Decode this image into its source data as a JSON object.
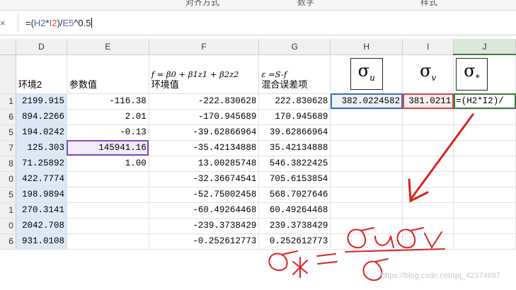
{
  "ribbon": {
    "labels": [
      "对齐方式",
      "数字",
      "样式"
    ]
  },
  "formula_bar": {
    "cancel_glyph": "×",
    "formula": {
      "p1": "=(",
      "ref1": "H2",
      "p2": "*",
      "ref2": "I2",
      "p3": ")/",
      "ref3": "E5",
      "p4": "^0.5"
    }
  },
  "colors": {
    "ref_h2": "#3b6fb6",
    "ref_i2": "#d24b4b",
    "ref_e5": "#7a4fc4",
    "annotation": "#e02020"
  },
  "columns": [
    "D",
    "E",
    "F",
    "G",
    "H",
    "I",
    "J"
  ],
  "header_row": {
    "d": "环境2",
    "e": "参数值",
    "f_formula": "f = β0 + β1z1 + β2z2",
    "f": "环境值",
    "g_formula": "ε =S-f",
    "g": "混合误差项",
    "h_sub": "u",
    "i_sub": "v",
    "j_sub": "*",
    "sigma": "σ"
  },
  "row_labels": [
    "1",
    "6",
    "5",
    "7",
    "8",
    "0",
    "5",
    "1",
    "0",
    "6"
  ],
  "rows": [
    {
      "d": "2199.915",
      "e": "-116.38",
      "f": "-222.830628",
      "g": "222.830628",
      "h": "382.0224582",
      "i": "381.0211",
      "j": "=(H2*I2)/"
    },
    {
      "d": "894.2266",
      "e": "2.01",
      "f": "-170.945689",
      "g": "170.945689",
      "h": "",
      "i": "",
      "j": ""
    },
    {
      "d": "194.0242",
      "e": "-0.13",
      "f": "-39.62866964",
      "g": "39.62866964",
      "h": "",
      "i": "",
      "j": ""
    },
    {
      "d": "125.303",
      "e": "145941.16",
      "f": "-35.42134888",
      "g": "35.42134888",
      "h": "",
      "i": "",
      "j": ""
    },
    {
      "d": "71.25892",
      "e": "1.00",
      "f": "13.00285748",
      "g": "546.3822425",
      "h": "",
      "i": "",
      "j": ""
    },
    {
      "d": "422.7774",
      "e": "",
      "f": "-32.36674541",
      "g": "705.6153854",
      "h": "",
      "i": "",
      "j": ""
    },
    {
      "d": "198.9894",
      "e": "",
      "f": "-52.75002458",
      "g": "568.7027646",
      "h": "",
      "i": "",
      "j": ""
    },
    {
      "d": "270.3141",
      "e": "",
      "f": "-60.49264468",
      "g": "60.49264468",
      "h": "",
      "i": "",
      "j": ""
    },
    {
      "d": "2042.708",
      "e": "",
      "f": "-239.3738429",
      "g": "239.3738429",
      "h": "",
      "i": "",
      "j": ""
    },
    {
      "d": "931.0108",
      "e": "",
      "f": "-0.252612773",
      "g": "0.252612773",
      "h": "",
      "i": "",
      "j": ""
    }
  ],
  "watermark": "https://blog.csdn.net/qq_42374697"
}
